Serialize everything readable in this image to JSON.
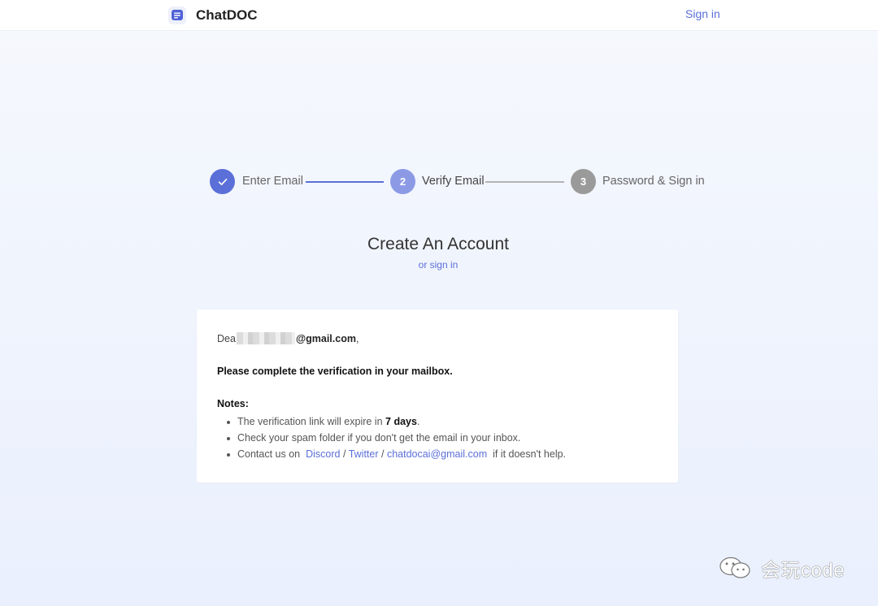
{
  "header": {
    "brand": "ChatDOC",
    "signin_label": "Sign in"
  },
  "steps": [
    {
      "number": "✓",
      "label": "Enter Email",
      "state": "done"
    },
    {
      "number": "2",
      "label": "Verify Email",
      "state": "active"
    },
    {
      "number": "3",
      "label": "Password & Sign in",
      "state": "pending"
    }
  ],
  "colors": {
    "accent": "#5b6fd8",
    "step_done": "#5b6fd8",
    "step_active": "#8c9ae6",
    "step_pending": "#9a9a9a"
  },
  "main": {
    "title": "Create An Account",
    "subtitle_link": "or sign in"
  },
  "card": {
    "dear_prefix": "Dea",
    "email_suffix": "@gmail.com",
    "dear_end": ",",
    "instruction": "Please complete the verification in your mailbox.",
    "notes_title": "Notes:",
    "note1_prefix": "The verification link will expire in ",
    "note1_bold": "7 days",
    "note1_suffix": ".",
    "note2": "Check your spam folder if you don't get the email in your inbox.",
    "note3_prefix": "Contact us on ",
    "discord": "Discord",
    "sep": "/",
    "twitter": "Twitter",
    "email_contact": "chatdocai@gmail.com",
    "note3_suffix": " if it doesn't help."
  },
  "watermark": {
    "text": "会玩code",
    "icon": "wechat-icon"
  }
}
